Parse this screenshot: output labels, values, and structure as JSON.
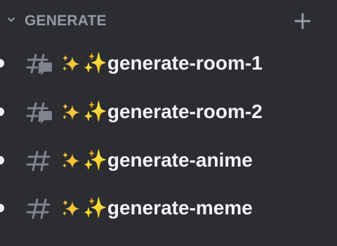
{
  "category": {
    "label": "GENERATE",
    "collapse_icon": "chevron-down-icon",
    "add_icon": "plus-icon"
  },
  "channels": [
    {
      "name": "✨generate-room-1",
      "icon": "text-channel-thread-icon",
      "unread": true
    },
    {
      "name": "✨generate-room-2",
      "icon": "text-channel-thread-icon",
      "unread": true
    },
    {
      "name": "✨generate-anime",
      "icon": "text-channel-icon",
      "unread": true
    },
    {
      "name": "✨generate-meme",
      "icon": "text-channel-icon",
      "unread": true
    }
  ],
  "colors": {
    "background": "#2b2d31",
    "muted": "#949ba4",
    "text": "#f2f3f5",
    "icon": "#80848e"
  }
}
